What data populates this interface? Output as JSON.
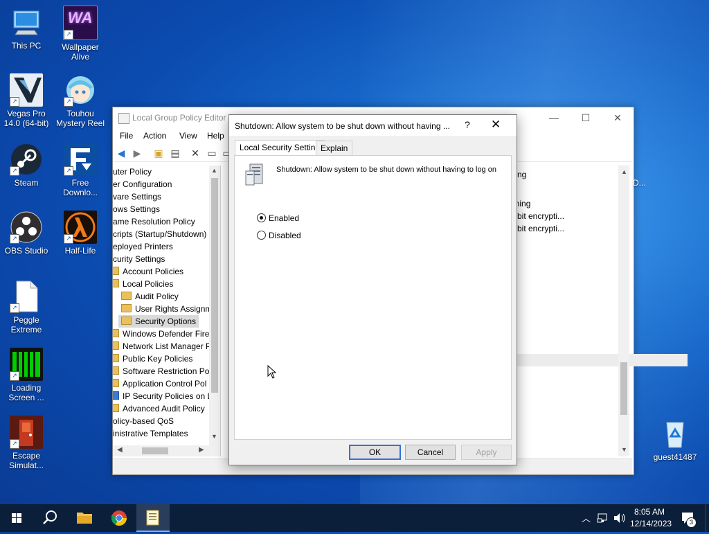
{
  "desktop": {
    "icons": [
      {
        "label": "This PC"
      },
      {
        "label": "Wallpaper Alive"
      },
      {
        "label": "Vegas Pro 14.0 (64-bit)"
      },
      {
        "label": "Touhou Mystery Reel"
      },
      {
        "label": "Steam"
      },
      {
        "label": "Free Downlo..."
      },
      {
        "label": "OBS Studio"
      },
      {
        "label": "Half-Life"
      },
      {
        "label": "Peggle Extreme"
      },
      {
        "label": "Loading Screen ..."
      },
      {
        "label": "Escape Simulat..."
      },
      {
        "label": "guest41487"
      }
    ],
    "wallpaper_alive_logo": "WA"
  },
  "gpe": {
    "title": "Local Group Policy Editor",
    "menu": [
      "File",
      "Action",
      "View",
      "Help"
    ],
    "tree": [
      "uter Policy",
      "er Configuration",
      "vare Settings",
      "ows Settings",
      "ame Resolution Policy",
      "cripts (Startup/Shutdown)",
      "eployed Printers",
      "curity Settings",
      "Account Policies",
      "Local Policies",
      "Audit Policy",
      "User Rights Assignm",
      "Security Options",
      "Windows Defender Firev",
      "Network List Manager P",
      "Public Key Policies",
      "Software Restriction Pol",
      "Application Control Pol",
      "IP Security Policies on L",
      "Advanced Audit Policy",
      "olicy-based QoS",
      "inistrative Templates"
    ],
    "right_fragments": [
      "ng",
      "gning",
      "bit encrypti...",
      "bit encrypti..."
    ],
    "right_outside_fragment": "D..."
  },
  "dialog": {
    "title": "Shutdown: Allow system to be shut down without having ...",
    "help_glyph": "?",
    "close_glyph": "✕",
    "tabs": [
      "Local Security Setting",
      "Explain"
    ],
    "policy_name": "Shutdown: Allow system to be shut down without having to log on",
    "options": [
      {
        "label": "Enabled",
        "selected": true
      },
      {
        "label": "Disabled",
        "selected": false
      }
    ],
    "buttons": {
      "ok": "OK",
      "cancel": "Cancel",
      "apply": "Apply"
    }
  },
  "taskbar": {
    "time": "8:05 AM",
    "date": "12/14/2023",
    "notification_count": "3"
  },
  "colors": {
    "accent": "#2f72d6",
    "taskbar": "#0c1f3a",
    "folder": "#e9c05b"
  }
}
